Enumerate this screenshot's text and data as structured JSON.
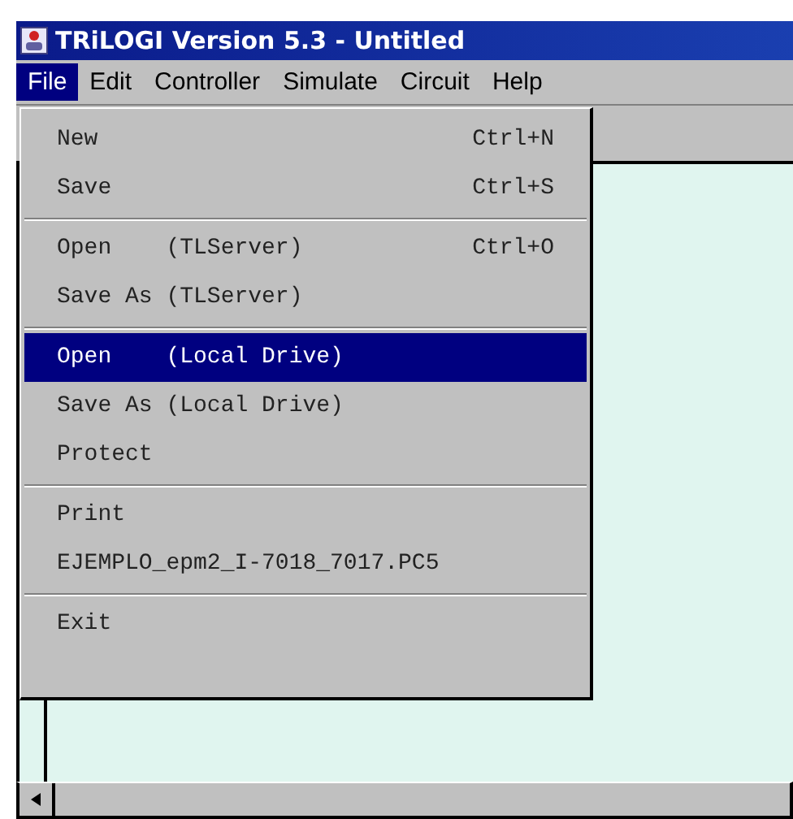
{
  "window": {
    "title": "TRiLOGI Version 5.3 - Untitled"
  },
  "menubar": [
    {
      "label": "File",
      "selected": true
    },
    {
      "label": "Edit",
      "selected": false
    },
    {
      "label": "Controller",
      "selected": false
    },
    {
      "label": "Simulate",
      "selected": false
    },
    {
      "label": "Circuit",
      "selected": false
    },
    {
      "label": "Help",
      "selected": false
    }
  ],
  "file_menu": [
    {
      "kind": "item",
      "label": "New",
      "shortcut": "Ctrl+N",
      "selected": false
    },
    {
      "kind": "item",
      "label": "Save",
      "shortcut": "Ctrl+S",
      "selected": false
    },
    {
      "kind": "separator"
    },
    {
      "kind": "item",
      "label": "Open    (TLServer)",
      "shortcut": "Ctrl+O",
      "selected": false
    },
    {
      "kind": "item",
      "label": "Save As (TLServer)",
      "selected": false
    },
    {
      "kind": "separator"
    },
    {
      "kind": "item",
      "label": "Open    (Local Drive)",
      "selected": true
    },
    {
      "kind": "item",
      "label": "Save As (Local Drive)",
      "selected": false
    },
    {
      "kind": "item",
      "label": "Protect",
      "selected": false
    },
    {
      "kind": "separator"
    },
    {
      "kind": "item",
      "label": "Print",
      "selected": false
    },
    {
      "kind": "item",
      "label": "EJEMPLO_epm2_I-7018_7017.PC5",
      "selected": false
    },
    {
      "kind": "separator"
    },
    {
      "kind": "item",
      "label": "Exit",
      "selected": false
    }
  ]
}
